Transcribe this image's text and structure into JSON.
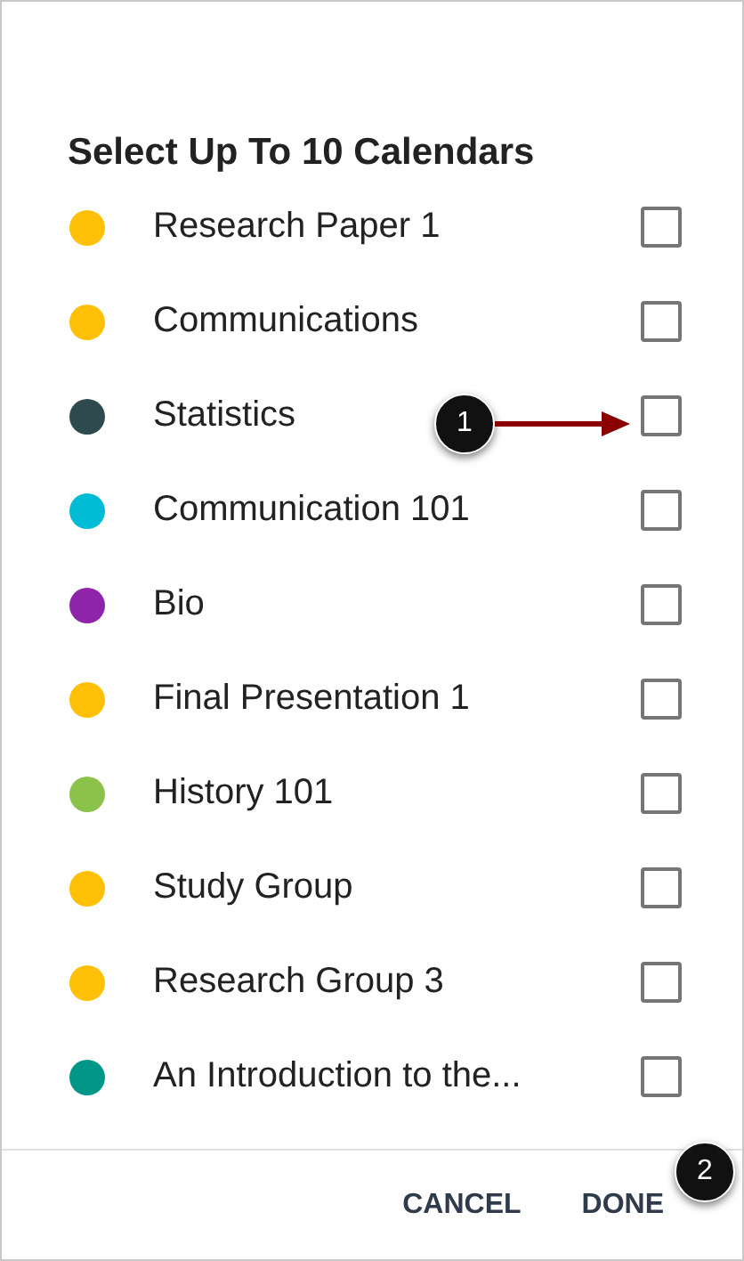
{
  "dialog": {
    "title": "Select Up To 10 Calendars",
    "calendars": [
      {
        "name": "Research Paper 1",
        "color": "#ffc107",
        "checked": false
      },
      {
        "name": "Communications",
        "color": "#ffc107",
        "checked": false
      },
      {
        "name": "Statistics",
        "color": "#2f4a4f",
        "checked": false,
        "callout": "1"
      },
      {
        "name": "Communication 101",
        "color": "#00bcd4",
        "checked": false
      },
      {
        "name": "Bio",
        "color": "#8e24aa",
        "checked": false
      },
      {
        "name": "Final Presentation 1",
        "color": "#ffc107",
        "checked": false
      },
      {
        "name": "History 101",
        "color": "#8bc34a",
        "checked": false
      },
      {
        "name": "Study Group",
        "color": "#ffc107",
        "checked": false
      },
      {
        "name": "Research Group 3",
        "color": "#ffc107",
        "checked": false
      },
      {
        "name": "An Introduction to the...",
        "color": "#009688",
        "checked": false
      }
    ],
    "buttons": [
      {
        "label": "CANCEL"
      },
      {
        "label": "DONE",
        "callout": "2"
      }
    ]
  }
}
